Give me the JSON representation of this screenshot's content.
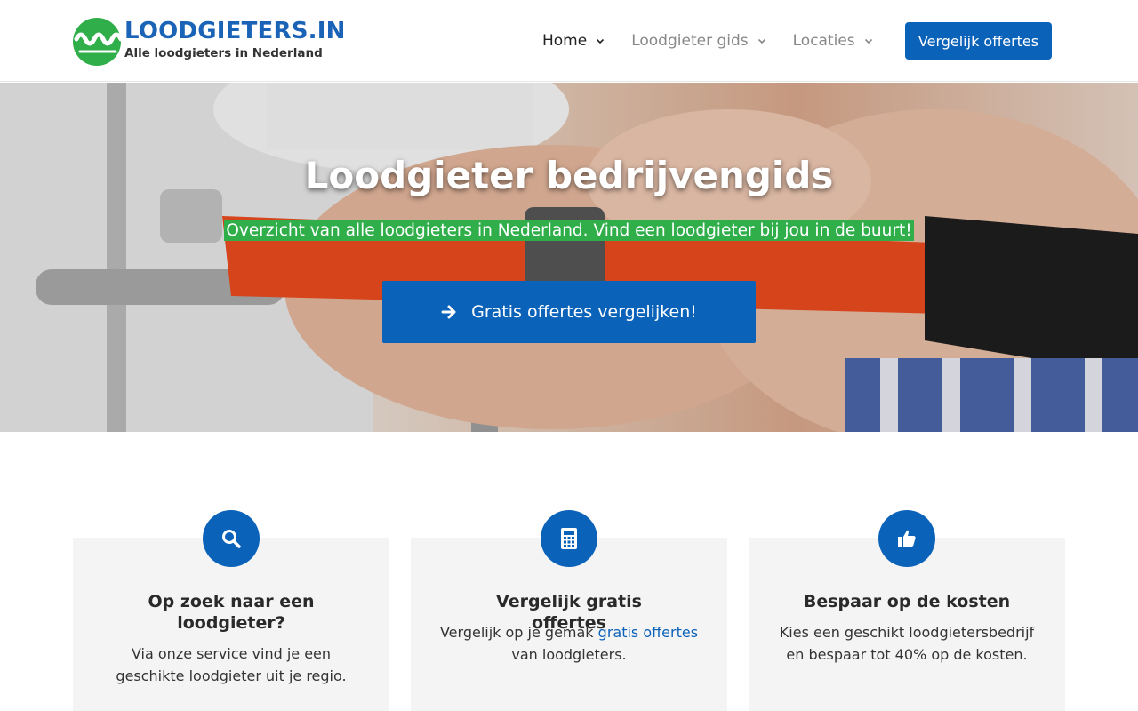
{
  "header": {
    "logo_title": "LOODGIETERS.IN",
    "logo_subtitle": "Alle loodgieters in Nederland",
    "nav": [
      {
        "label": "Home",
        "active": true
      },
      {
        "label": "Loodgieter gids",
        "active": false
      },
      {
        "label": "Locaties",
        "active": false
      }
    ],
    "cta_label": "Vergelijk offertes"
  },
  "hero": {
    "title": "Loodgieter bedrijvengids",
    "subtitle": "Overzicht van alle loodgieters in Nederland. Vind een loodgieter bij jou in de buurt!",
    "button_label": "Gratis offertes vergelijken!"
  },
  "features": [
    {
      "icon": "search-icon",
      "title": "Op zoek naar een loodgieter?",
      "text": "Via onze service vind je een geschikte loodgieter uit je regio."
    },
    {
      "icon": "calculator-icon",
      "title": "Vergelijk gratis offertes",
      "text_before": "Vergelijk op je gemak ",
      "link": "gratis offertes",
      "text_after": "van loodgieters."
    },
    {
      "icon": "thumbs-up-icon",
      "title": "Bespaar op de kosten",
      "text": "Kies een geschikt loodgietersbedrijf en bespaar tot 40% op de kosten."
    }
  ],
  "colors": {
    "brand_blue": "#0a62b9",
    "brand_green": "#2fae4a"
  }
}
